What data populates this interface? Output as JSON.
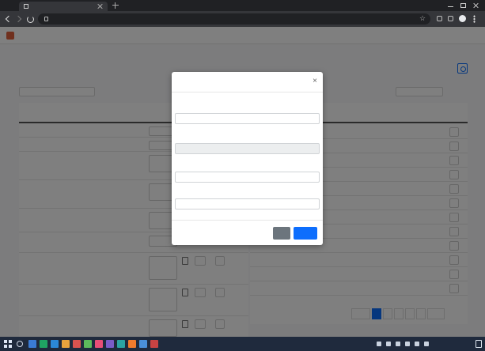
{
  "browser": {
    "tab_title": "",
    "url": ""
  },
  "app": {
    "brand": "",
    "nav_center": "",
    "nav_user": "",
    "section_title": "",
    "filter_left": "",
    "filter_right": ""
  },
  "left_table": {
    "caption": "",
    "headers": [
      "",
      "",
      ""
    ],
    "rows": [
      {
        "id": "",
        "name": "",
        "type": ""
      },
      {
        "id": "",
        "name": "",
        "type": ""
      },
      {
        "id": "",
        "name": "",
        "type": ""
      },
      {
        "id": "",
        "name": "",
        "type": ""
      },
      {
        "id": "",
        "name": "",
        "type": ""
      },
      {
        "id": "",
        "name": "",
        "type": ""
      },
      {
        "id": "",
        "name": "",
        "type": ""
      },
      {
        "id": "",
        "name": "",
        "type": ""
      },
      {
        "id": "",
        "name": "",
        "type": ""
      },
      {
        "id": "",
        "name": "",
        "type": ""
      }
    ]
  },
  "right_table": {
    "headers": [
      "",
      "",
      ""
    ],
    "rows": [
      {
        "a": "",
        "b": "",
        "c": ""
      },
      {
        "a": "",
        "b": "",
        "c": ""
      },
      {
        "a": "",
        "b": "",
        "c": ""
      },
      {
        "a": "",
        "b": "",
        "c": ""
      },
      {
        "a": "",
        "b": "",
        "c": ""
      },
      {
        "a": "",
        "b": "",
        "c": ""
      },
      {
        "a": "",
        "b": "",
        "c": ""
      },
      {
        "a": "",
        "b": "",
        "c": ""
      },
      {
        "a": "",
        "b": "",
        "c": ""
      },
      {
        "a": "",
        "b": "",
        "c": ""
      },
      {
        "a": "",
        "b": "",
        "c": ""
      },
      {
        "a": "",
        "b": "",
        "c": ""
      }
    ],
    "pager_info": "",
    "pager": {
      "prev": "",
      "p1": "",
      "p2": "",
      "p3": "",
      "p4": "",
      "dots": "",
      "next": ""
    }
  },
  "modal": {
    "title": "",
    "close_symbol": "×",
    "fields": [
      {
        "label": "",
        "value": "",
        "placeholder": ""
      },
      {
        "label": "",
        "value": "",
        "placeholder": ""
      },
      {
        "label": "",
        "value": "",
        "placeholder": ""
      },
      {
        "label": "",
        "value": "",
        "placeholder": ""
      }
    ],
    "close_button": "",
    "save_button": ""
  },
  "taskbar": {
    "clock": ""
  },
  "colors": {
    "primary": "#0d6efd",
    "secondary": "#6c757d",
    "brand": "#e0603c",
    "chrome_dark": "#202124",
    "taskbar": "#1f2a3d"
  },
  "icons": [
    "tab-favicon-icon",
    "tab-close-icon",
    "new-tab-icon",
    "back-icon",
    "forward-icon",
    "reload-icon",
    "lock-icon",
    "bookmark-star-icon",
    "extension-icon",
    "profile-avatar-icon",
    "browser-menu-icon",
    "brand-logo-icon",
    "help-icon",
    "modal-close-icon",
    "windows-start-icon",
    "taskbar-search-icon",
    "notification-icon"
  ]
}
